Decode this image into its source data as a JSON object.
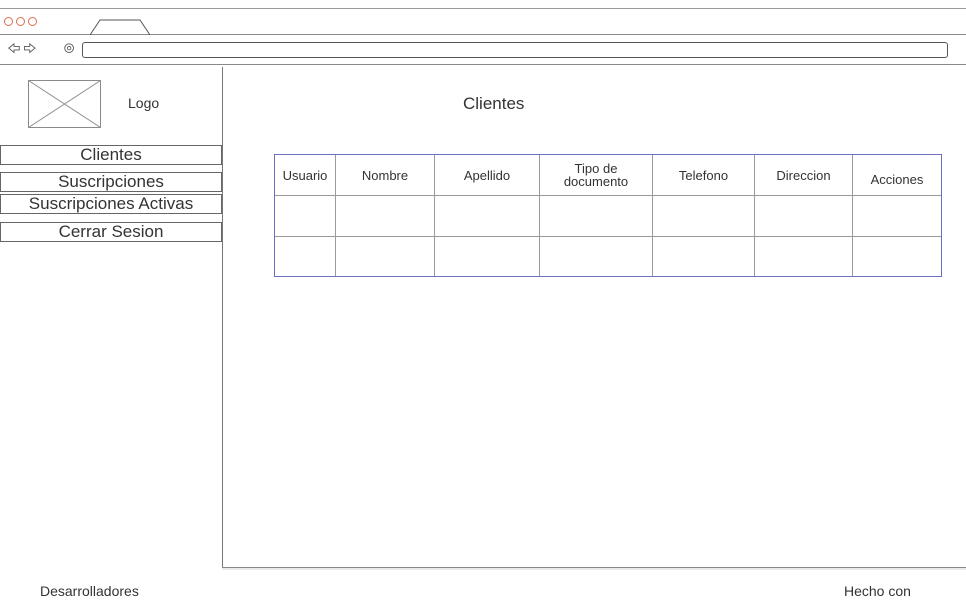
{
  "browser": {
    "window_controls": [
      "close",
      "minimize",
      "maximize"
    ],
    "address_icon": "at-icon",
    "url": ""
  },
  "sidebar": {
    "logo_label": "Logo",
    "items": [
      {
        "label": "Clientes"
      },
      {
        "label": "Suscripciones"
      },
      {
        "label": "Suscripciones Activas"
      },
      {
        "label": "Cerrar Sesion"
      }
    ]
  },
  "main": {
    "title": "Clientes",
    "table": {
      "headers": [
        "Usuario",
        "Nombre",
        "Apellido",
        "Tipo de documento",
        "Telefono",
        "Direccion",
        "Acciones"
      ],
      "rows": [
        [
          "",
          "",
          "",
          "",
          "",
          "",
          ""
        ],
        [
          "",
          "",
          "",
          "",
          "",
          "",
          ""
        ]
      ]
    }
  },
  "footer": {
    "left": "Desarrolladores",
    "right": "Hecho con"
  },
  "colors": {
    "window_dot": "#d9704c",
    "table_border": "#6a6fc0",
    "line": "#777777"
  }
}
